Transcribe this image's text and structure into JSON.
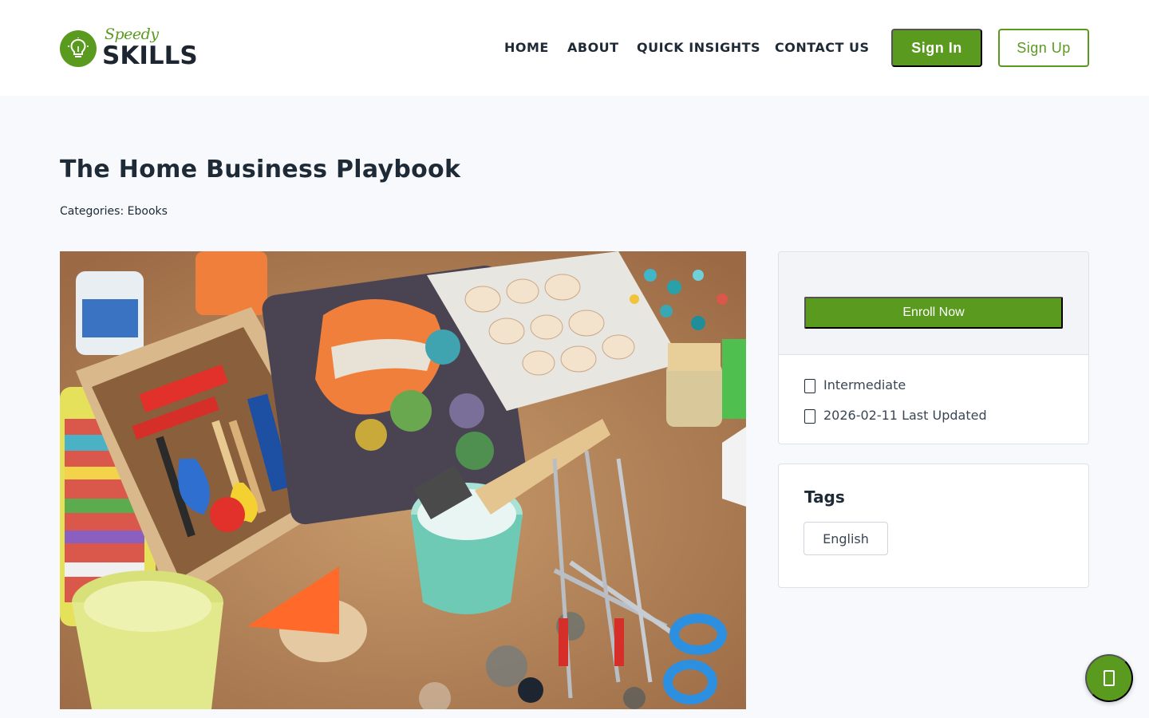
{
  "brand": {
    "script": "Speedy",
    "word": "SKILLS",
    "icon": "lightbulb-icon",
    "color": "#5a9a1f"
  },
  "nav": {
    "items": [
      {
        "label": "HOME"
      },
      {
        "label": "ABOUT"
      },
      {
        "label": "QUICK INSIGHTS"
      },
      {
        "label": "CONTACT US"
      }
    ],
    "sign_in": "Sign In",
    "sign_up": "Sign Up"
  },
  "course": {
    "title": "The Home Business Playbook",
    "categories_label": "Categories:",
    "category": "Ebooks",
    "image_alt": "Craft table with paint brushes, scissors, beads and seashells"
  },
  "enroll": {
    "button": "Enroll Now",
    "level": "Intermediate",
    "level_icon": "level-icon",
    "updated_date": "2026-02-11",
    "updated_label": "Last Updated",
    "updated_icon": "calendar-icon"
  },
  "tags": {
    "title": "Tags",
    "items": [
      "English"
    ]
  },
  "fab": {
    "icon": "chat-icon"
  }
}
